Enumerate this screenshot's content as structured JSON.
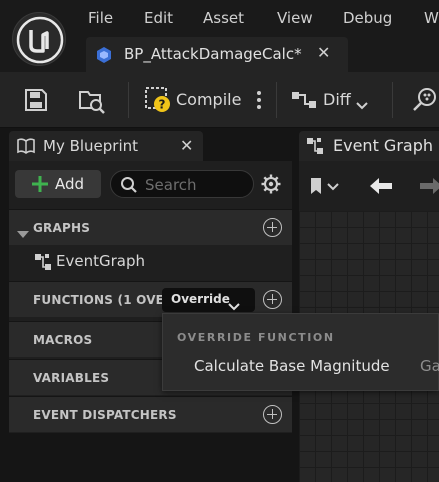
{
  "menu": {
    "items": [
      "File",
      "Edit",
      "Asset",
      "View",
      "Debug",
      "W"
    ]
  },
  "document_tab": {
    "title": "BP_AttackDamageCalc*"
  },
  "toolbar": {
    "compile_label": "Compile",
    "diff_label": "Diff"
  },
  "my_blueprint": {
    "tab_label": "My Blueprint",
    "add_label": "Add",
    "search_placeholder": "Search",
    "sections": {
      "graphs": "GRAPHS",
      "functions": "FUNCTIONS (1 OVERR",
      "macros": "MACROS",
      "variables": "VARIABLES",
      "event_dispatchers": "EVENT DISPATCHERS"
    },
    "graph_items": [
      "EventGraph"
    ],
    "override_button_label": "Override"
  },
  "graph_panel": {
    "tab_label": "Event Graph"
  },
  "override_menu": {
    "header": "OVERRIDE FUNCTION",
    "items": [
      "Calculate Base Magnitude",
      "Ga"
    ]
  },
  "colors": {
    "accent_green": "#3fb34f",
    "compile_warning_yellow": "#f0c419",
    "background": "#151515",
    "panel": "#1f1f1f",
    "section_header": "#2a2a2a"
  }
}
